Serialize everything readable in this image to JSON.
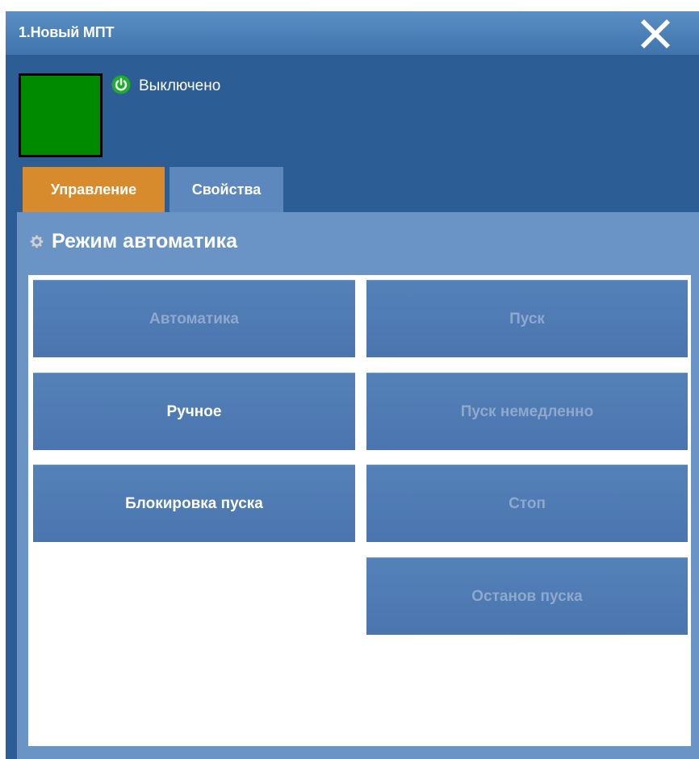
{
  "window": {
    "title": "1.Новый МПТ"
  },
  "status": {
    "text": "Выключено",
    "indicator_color": "#008a00",
    "icon": "power-icon"
  },
  "tabs": [
    {
      "label": "Управление",
      "active": true
    },
    {
      "label": "Свойства",
      "active": false
    }
  ],
  "panel": {
    "title": "Режим автоматика",
    "icon": "gear-icon"
  },
  "buttons": {
    "auto": {
      "label": "Автоматика",
      "enabled": false
    },
    "manual": {
      "label": "Ручное",
      "enabled": true
    },
    "block_start": {
      "label": "Блокировка пуска",
      "enabled": true
    },
    "start": {
      "label": "Пуск",
      "enabled": false
    },
    "start_now": {
      "label": "Пуск немедленно",
      "enabled": false
    },
    "stop": {
      "label": "Стоп",
      "enabled": false
    },
    "halt_start": {
      "label": "Останов пуска",
      "enabled": false
    }
  },
  "colors": {
    "window_bg": "#2c5d95",
    "active_tab": "#d88b2c",
    "button": "#5581b9"
  }
}
